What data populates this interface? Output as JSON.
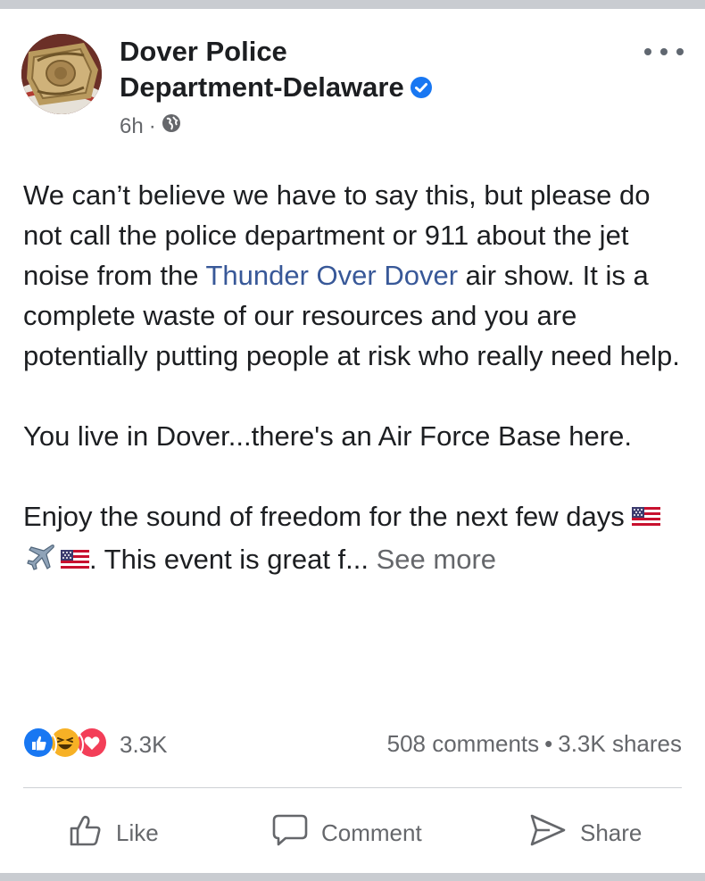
{
  "post": {
    "author": "Dover Police Department-Delaware",
    "author_line1": "Dover Police",
    "author_line2": "Department-Delaware",
    "verified": true,
    "time": "6h",
    "separator": "·",
    "privacy_icon": "globe-icon",
    "more_icon": "more-horizontal-icon",
    "paragraph1_a": "We can’t believe we have to say this, but please do not call the police department or 911 about the jet noise from the ",
    "paragraph1_link": "Thunder Over Dover",
    "paragraph1_b": " air show.  It is a complete waste of our resources and you are potentially putting people at risk who really need help.",
    "paragraph2": "You live in Dover...there's an Air Force Base here.",
    "paragraph3_a": "Enjoy the sound of freedom for the next few days ",
    "paragraph3_b": ".  This event is great f... ",
    "see_more": "See more",
    "emojis": [
      "us-flag-emoji",
      "airplane-emoji",
      "us-flag-emoji"
    ]
  },
  "stats": {
    "reaction_icons": [
      "like-reaction-icon",
      "haha-reaction-icon",
      "love-reaction-icon"
    ],
    "reaction_count": "3.3K",
    "comments": "508 comments",
    "separator": "•",
    "shares": "3.3K shares"
  },
  "actions": {
    "like": "Like",
    "comment": "Comment",
    "share": "Share"
  },
  "colors": {
    "link": "#385898",
    "secondary_text": "#65676b",
    "verified_blue": "#1877f2",
    "like_blue": "#1877f2",
    "love_red": "#f33e58",
    "haha_yellow": "#f7b125"
  }
}
